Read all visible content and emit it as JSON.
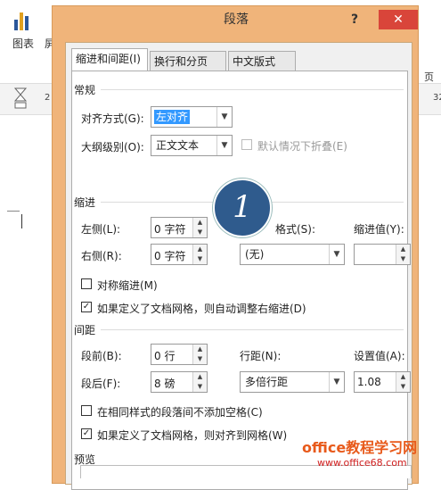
{
  "background": {
    "ribbon_label_1": "图表",
    "ribbon_label_2": "屏",
    "ruler_number_left": "2",
    "ruler_number_right": "32",
    "ribbon_label_right": "页脚"
  },
  "dialog": {
    "title": "段落",
    "help": "?",
    "close": "✕",
    "tabs": [
      {
        "label": "缩进和间距(I)",
        "active": true
      },
      {
        "label": "换行和分页(P)",
        "active": false
      },
      {
        "label": "中文版式(H)",
        "active": false
      }
    ],
    "general": {
      "heading": "常规",
      "alignment_label": "对齐方式(G):",
      "alignment_value": "左对齐",
      "outline_label": "大纲级别(O):",
      "outline_value": "正文文本",
      "collapse_label": "默认情况下折叠(E)"
    },
    "indent": {
      "heading": "缩进",
      "left_label": "左侧(L):",
      "left_value": "0 字符",
      "right_label": "右侧(R):",
      "right_value": "0 字符",
      "special_label": "特殊格式(S):",
      "special_label_visible": "格式(S):",
      "special_value": "(无)",
      "by_label": "缩进值(Y):",
      "by_value": "",
      "mirror_label": "对称缩进(M)",
      "mirror_checked": false,
      "auto_adjust_label": "如果定义了文档网格，则自动调整右缩进(D)",
      "auto_adjust_checked": true
    },
    "spacing": {
      "heading": "间距",
      "before_label": "段前(B):",
      "before_value": "0 行",
      "after_label": "段后(F):",
      "after_value": "8 磅",
      "line_label": "行距(N):",
      "line_value": "多倍行距",
      "at_label": "设置值(A):",
      "at_value": "1.08",
      "no_space_label": "在相同样式的段落间不添加空格(C)",
      "no_space_checked": false,
      "snap_grid_label": "如果定义了文档网格，则对齐到网格(W)",
      "snap_grid_checked": true
    },
    "preview": {
      "heading": "预览"
    }
  },
  "callout": {
    "number": "1"
  },
  "watermark": {
    "line1": "office教程学习网",
    "line2": "www.office68.com"
  },
  "colors": {
    "frame": "#f0b47a",
    "close": "#d9453a",
    "selection": "#3399ff",
    "callout": "#2f5b8d",
    "watermark": "#e85a1b"
  }
}
